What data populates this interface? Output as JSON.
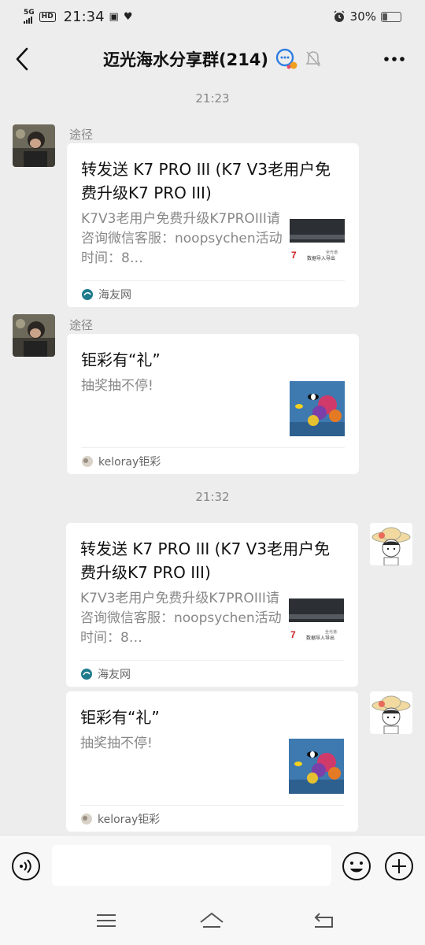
{
  "status_bar": {
    "network": "5G",
    "hd": "HD",
    "time": "21:34",
    "battery": "30%",
    "battery_level": 0.3
  },
  "header": {
    "title": "迈光海水分享群(214)"
  },
  "messages": [
    {
      "time": "21:23",
      "sender": "途径",
      "title": "转发送 K7 PRO III (K7 V3老用户免费升级K7 PRO III)",
      "desc": "K7V3老用户免费升级K7PROIII请咨询微信客服：noopsychen活动时间：8…",
      "source": "海友网"
    },
    {
      "sender": "途径",
      "title": "钜彩有“礼”",
      "desc": "抽奖抽不停!",
      "source": "keloray钜彩"
    },
    {
      "time": "21:32",
      "title": "转发送 K7 PRO III (K7 V3老用户免费升级K7 PRO III)",
      "desc": "K7V3老用户免费升级K7PROIII请咨询微信客服：noopsychen活动时间：8…",
      "source": "海友网"
    },
    {
      "title": "钜彩有“礼”",
      "desc": "抽奖抽不停!",
      "source": "keloray钜彩"
    }
  ],
  "thumb_text": {
    "k7_label": "数据导入导出",
    "k7_small": "全光谱·"
  },
  "colors": {
    "background": "#ededed",
    "card": "#ffffff",
    "muted_text": "#888888"
  }
}
